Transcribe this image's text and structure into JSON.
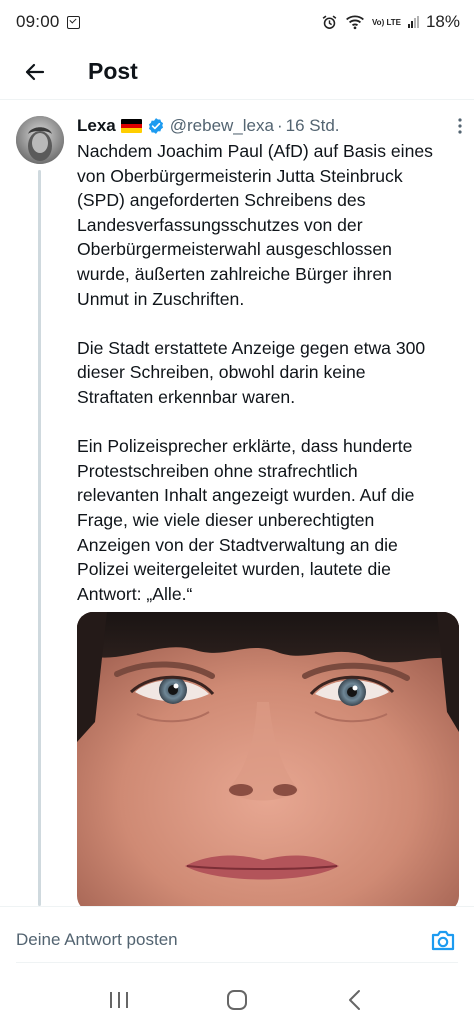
{
  "status_bar": {
    "time": "09:00",
    "battery": "18%",
    "network": "Vo) LTE"
  },
  "header": {
    "title": "Post",
    "back_icon": "arrow-left-icon"
  },
  "tweet": {
    "author": "Lexa",
    "flag": "🇩🇪",
    "handle": "@rebew_lexa",
    "separator": "·",
    "time": "16 Std.",
    "paragraphs": [
      {
        "lines": [
          "Nachdem Joachim Paul (AfD) auf Basis eines",
          "von Oberbürgermeisterin Jutta Steinbruck",
          "(SPD) angeforderten Schreibens des",
          "Landesverfassungsschutzes von der",
          "Oberbürgermeisterwahl ausgeschlossen",
          "wurde, äußerten zahlreiche Bürger ihren",
          "Unmut in Zuschriften."
        ]
      },
      {
        "lines": [
          "Die Stadt erstattete Anzeige gegen etwa 300",
          "dieser Schreiben, obwohl darin keine",
          "Straftaten erkennbar waren."
        ]
      },
      {
        "lines": [
          "Ein Polizeisprecher erklärte, dass hunderte",
          "Protestschreiben ohne strafrechtlich",
          "relevanten Inhalt angezeigt wurden. Auf die",
          "Frage, wie viele dieser unberechtigten",
          "Anzeigen von der Stadtverwaltung an die",
          "Polizei weitergeleitet wurden, lautete die",
          "Antwort: „Alle.“"
        ]
      }
    ]
  },
  "reply": {
    "placeholder": "Deine Antwort posten"
  },
  "colors": {
    "text": "#0f1419",
    "secondary": "#536471",
    "accent": "#1d9bf0",
    "thread_line": "#cfd9de"
  },
  "nav": {
    "recents_icon": "recents-icon",
    "home_icon": "home-icon",
    "back_icon": "nav-back-icon"
  }
}
